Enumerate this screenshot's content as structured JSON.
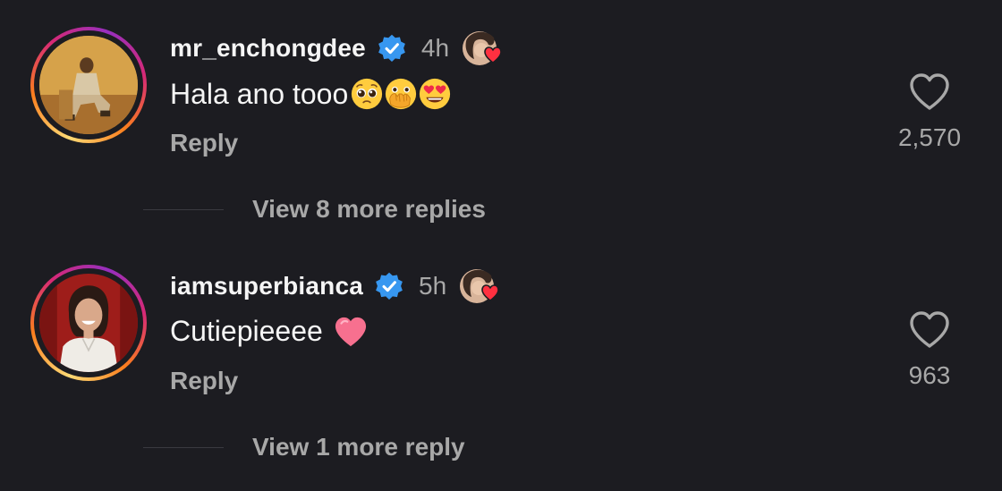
{
  "colors": {
    "background": "#1c1c21",
    "text_primary": "#f5f5f5",
    "text_secondary": "#a8a8a8",
    "verified_blue": "#3797f0",
    "heart_red": "#ff3040"
  },
  "comments": [
    {
      "username": "mr_enchongdee",
      "verified": true,
      "time": "4h",
      "liked_by_creator": true,
      "text": "Hala ano tooo",
      "emojis": [
        "pleading-face-icon",
        "face-with-open-eyes-and-hand-over-mouth-icon",
        "smiling-face-with-heart-eyes-icon"
      ],
      "reply_label": "Reply",
      "like_count": "2,570",
      "view_more": "View 8 more replies"
    },
    {
      "username": "iamsuperbianca",
      "verified": true,
      "time": "5h",
      "liked_by_creator": true,
      "text": "Cutiepieeee",
      "emojis": [
        "pink-heart-icon"
      ],
      "reply_label": "Reply",
      "like_count": "963",
      "view_more": "View 1 more reply"
    }
  ]
}
